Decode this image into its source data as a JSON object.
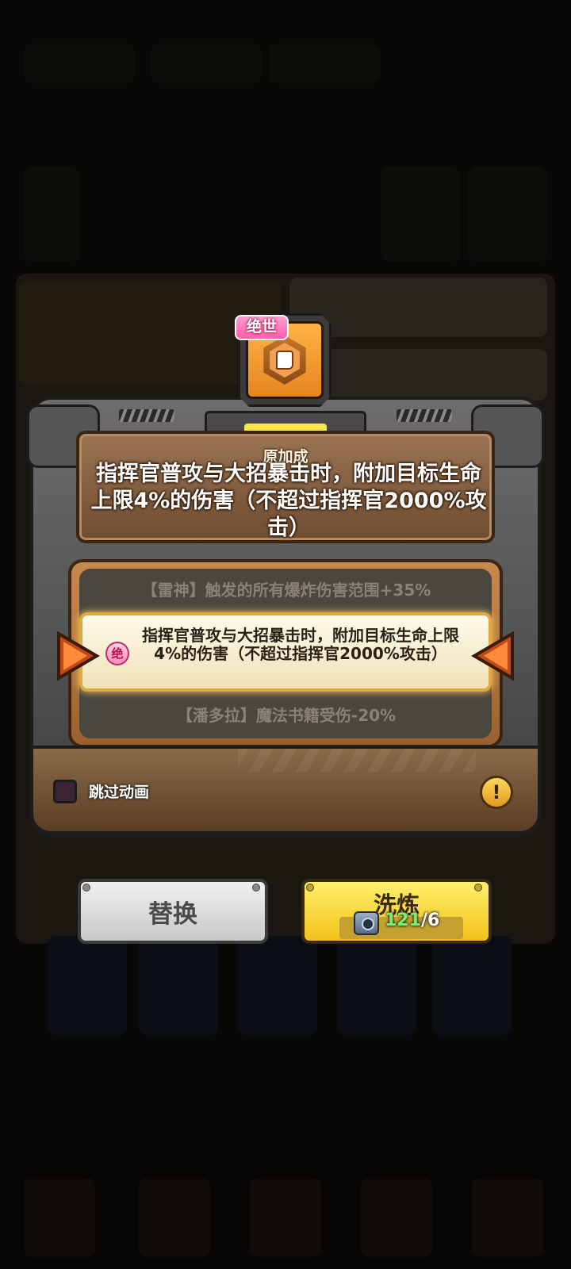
{
  "item": {
    "rarity_tag": "绝世",
    "icon": "boot-icon"
  },
  "original_bonus": {
    "title": "原加成",
    "text": "指挥官普攻与大招暴击时，附加目标生命上限4%的伤害（不超过指挥官2000%攻击）"
  },
  "options": {
    "previous": "【雷神】触发的所有爆炸伤害范围+35%",
    "selected_badge": "绝",
    "selected": "指挥官普攻与大招暴击时，附加目标生命上限4%的伤害（不超过指挥官2000%攻击）",
    "next": "【潘多拉】魔法书籍受伤-20%"
  },
  "skip_animation": {
    "label": "跳过动画",
    "checked": false
  },
  "info_icon": "!",
  "buttons": {
    "replace_label": "替换",
    "refine_label": "洗炼",
    "cost_have": "121",
    "cost_need": "/6",
    "cost_icon": "toolbox-icon"
  },
  "colors": {
    "accent_yellow": "#f2c21a",
    "rarity_pink": "#ff5ea8",
    "cost_green": "#7cf070"
  }
}
